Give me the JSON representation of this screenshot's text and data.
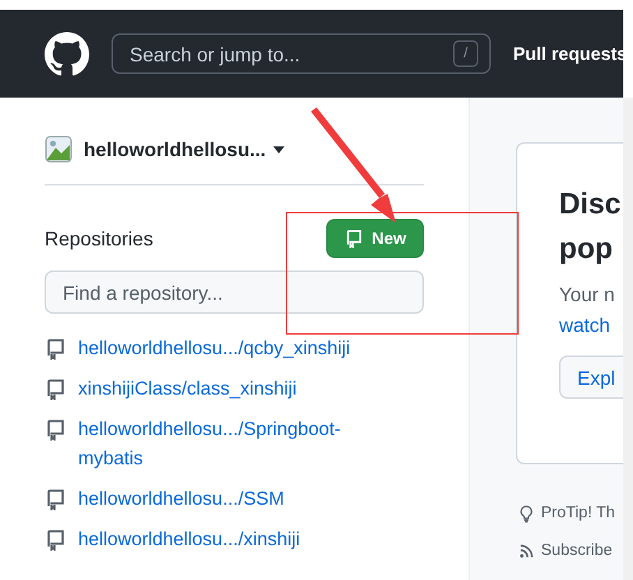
{
  "header": {
    "search": {
      "placeholder": "Search or jump to...",
      "shortcut": "/"
    },
    "nav": [
      "Pull requests"
    ]
  },
  "sidebar": {
    "user": {
      "name": "helloworldhellosu..."
    },
    "repositories": {
      "title": "Repositories",
      "new_button": "New",
      "filter": {
        "placeholder": "Find a repository..."
      },
      "items": [
        {
          "name": "helloworldhellosu.../qcby_xinshiji"
        },
        {
          "name": "xinshijiClass/class_xinshiji"
        },
        {
          "name": "helloworldhellosu.../Springboot-mybatis"
        },
        {
          "name": "helloworldhellosu.../SSM"
        },
        {
          "name": "helloworldhellosu.../xinshiji"
        }
      ]
    }
  },
  "main": {
    "card": {
      "heading": [
        "Disc",
        "pop"
      ],
      "text": "Your n",
      "link": "watch",
      "button": "Expl"
    },
    "tips": [
      {
        "kind": "protip",
        "text": "ProTip! Th"
      },
      {
        "kind": "subscribe",
        "text": "Subscribe"
      }
    ]
  }
}
